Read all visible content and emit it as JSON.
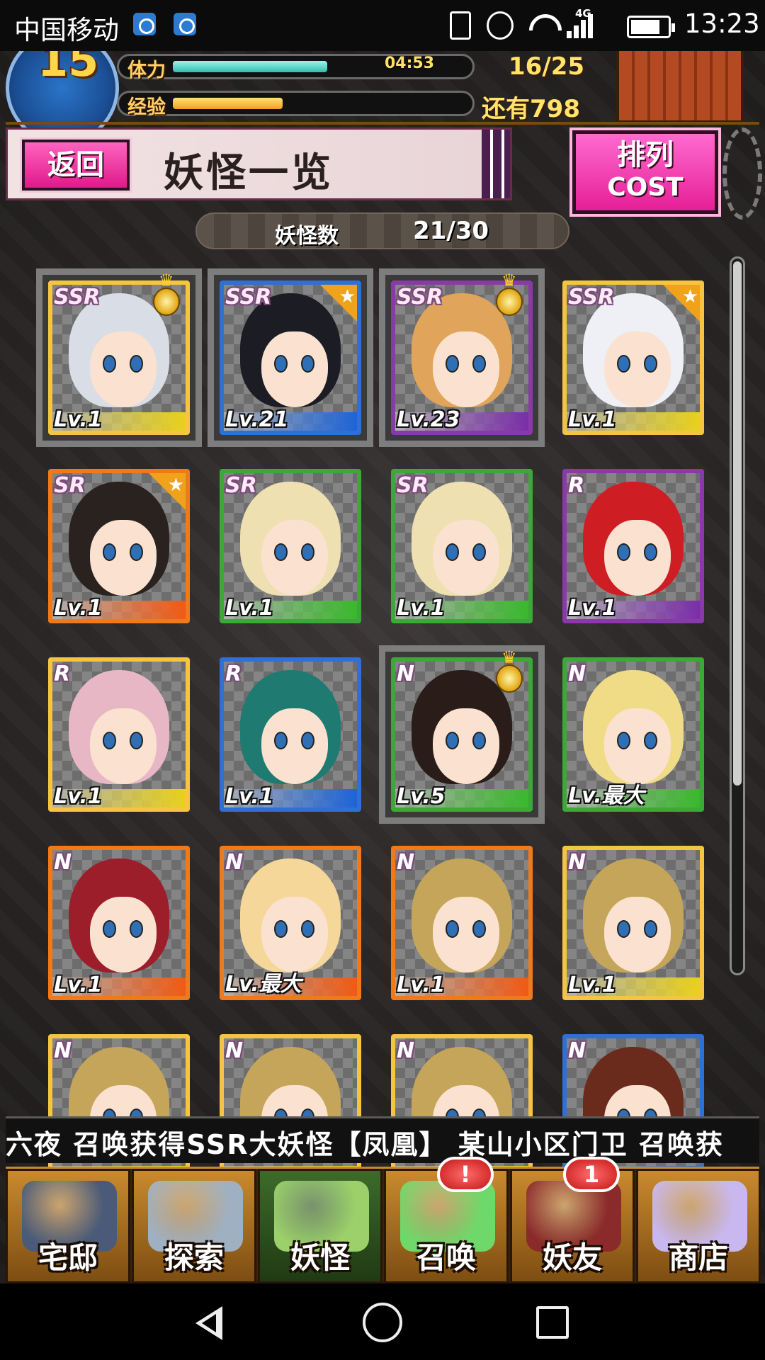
{
  "status_bar": {
    "carrier": "中国移动",
    "net_type": "4G",
    "time": "13:23"
  },
  "header": {
    "level": "15",
    "stamina_label": "体力",
    "stamina_timer": "04:53",
    "stamina_count": "16/25",
    "stamina_fraction": 0.64,
    "exp_label": "经验",
    "exp_remaining": "还有798",
    "exp_fraction": 0.37
  },
  "title_bar": {
    "back_label": "返回",
    "page_title": "妖怪一览",
    "sort_label": "排列",
    "sort_value": "COST"
  },
  "count_bar": {
    "label": "妖怪数",
    "value": "21/30"
  },
  "scrollbar": {
    "visible_fraction": 0.74
  },
  "cards": [
    {
      "rarity": "SSR",
      "level": "Lv.1",
      "frame": "#f5c542",
      "bar": "#e8d11c",
      "hair": "#d9dee6",
      "selected": true,
      "star": false,
      "medal": true
    },
    {
      "rarity": "SSR",
      "level": "Lv.21",
      "frame": "#2f6fd8",
      "bar": "#1e63d6",
      "hair": "#1c1c24",
      "selected": true,
      "star": true,
      "medal": false
    },
    {
      "rarity": "SSR",
      "level": "Lv.23",
      "frame": "#8a3aa8",
      "bar": "#7a2ea8",
      "hair": "#e0a55a",
      "selected": true,
      "star": false,
      "medal": true
    },
    {
      "rarity": "SSR",
      "level": "Lv.1",
      "frame": "#f5c542",
      "bar": "#e8d11c",
      "hair": "#eef0f6",
      "selected": false,
      "star": true,
      "medal": false
    },
    {
      "rarity": "SR",
      "level": "Lv.1",
      "frame": "#f07a1a",
      "bar": "#f05a14",
      "hair": "#2a221e",
      "selected": false,
      "star": true,
      "medal": false
    },
    {
      "rarity": "SR",
      "level": "Lv.1",
      "frame": "#3ca838",
      "bar": "#3ab82c",
      "hair": "#eee0b0",
      "selected": false,
      "star": false,
      "medal": false
    },
    {
      "rarity": "SR",
      "level": "Lv.1",
      "frame": "#3ca838",
      "bar": "#3ab82c",
      "hair": "#eee0b0",
      "selected": false,
      "star": false,
      "medal": false
    },
    {
      "rarity": "R",
      "level": "Lv.1",
      "frame": "#8a3aa8",
      "bar": "#7a2ea8",
      "hair": "#cf1d24",
      "selected": false,
      "star": false,
      "medal": false
    },
    {
      "rarity": "R",
      "level": "Lv.1",
      "frame": "#f5c542",
      "bar": "#e8d11c",
      "hair": "#e8b7c6",
      "selected": false,
      "star": false,
      "medal": false
    },
    {
      "rarity": "R",
      "level": "Lv.1",
      "frame": "#2f6fd8",
      "bar": "#1e63d6",
      "hair": "#1f7a72",
      "selected": false,
      "star": false,
      "medal": false
    },
    {
      "rarity": "N",
      "level": "Lv.5",
      "frame": "#3ca838",
      "bar": "#3ab82c",
      "hair": "#2a1c18",
      "selected": true,
      "star": false,
      "medal": true
    },
    {
      "rarity": "N",
      "level": "Lv.最大",
      "frame": "#3ca838",
      "bar": "#3ab82c",
      "hair": "#f0dc86",
      "selected": false,
      "star": false,
      "medal": false
    },
    {
      "rarity": "N",
      "level": "Lv.1",
      "frame": "#f07a1a",
      "bar": "#f05a14",
      "hair": "#9c1e2a",
      "selected": false,
      "star": false,
      "medal": false
    },
    {
      "rarity": "N",
      "level": "Lv.最大",
      "frame": "#f07a1a",
      "bar": "#f05a14",
      "hair": "#f5d79a",
      "selected": false,
      "star": false,
      "medal": false
    },
    {
      "rarity": "N",
      "level": "Lv.1",
      "frame": "#f07a1a",
      "bar": "#f05a14",
      "hair": "#c4a55a",
      "selected": false,
      "star": false,
      "medal": false
    },
    {
      "rarity": "N",
      "level": "Lv.1",
      "frame": "#f5c542",
      "bar": "#e8d11c",
      "hair": "#c4a55a",
      "selected": false,
      "star": false,
      "medal": false
    },
    {
      "rarity": "N",
      "level": "",
      "frame": "#f5c542",
      "bar": "#e8d11c",
      "hair": "#c4a55a",
      "selected": false,
      "star": false,
      "medal": false
    },
    {
      "rarity": "N",
      "level": "",
      "frame": "#f5c542",
      "bar": "#e8d11c",
      "hair": "#c4a55a",
      "selected": false,
      "star": false,
      "medal": false
    },
    {
      "rarity": "N",
      "level": "",
      "frame": "#f5c542",
      "bar": "#e8d11c",
      "hair": "#c4a55a",
      "selected": false,
      "star": false,
      "medal": false
    },
    {
      "rarity": "N",
      "level": "",
      "frame": "#2f6fd8",
      "bar": "#1e63d6",
      "hair": "#6a2a1c",
      "selected": false,
      "star": false,
      "medal": false
    }
  ],
  "ticker": {
    "text": "六夜 召唤获得SSR大妖怪【凤凰】    某山小区门卫 召唤获"
  },
  "bottom_nav": [
    {
      "label": "宅邸",
      "art": "#4a5a78",
      "active": false,
      "badge": ""
    },
    {
      "label": "探索",
      "art": "#9fb0c2",
      "active": false,
      "badge": ""
    },
    {
      "label": "妖怪",
      "art": "#9bd06a",
      "active": true,
      "badge": ""
    },
    {
      "label": "召唤",
      "art": "#6fd86a",
      "active": false,
      "badge": "!"
    },
    {
      "label": "妖友",
      "art": "#8a2a2a",
      "active": false,
      "badge": "1"
    },
    {
      "label": "商店",
      "art": "#c9b8f0",
      "active": false,
      "badge": ""
    }
  ],
  "icons": {
    "status": [
      "app-icon-a",
      "app-icon-b",
      "vibrate-icon",
      "alarm-icon",
      "wifi-icon",
      "signal-icon",
      "battery-icon"
    ],
    "android_nav": [
      "back-icon",
      "home-icon",
      "recent-apps-icon"
    ]
  }
}
